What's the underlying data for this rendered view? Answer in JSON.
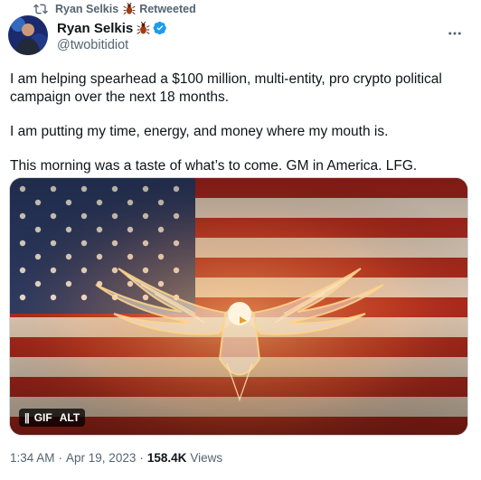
{
  "retweet": {
    "retweeter": "Ryan Selkis",
    "label": "Retweeted"
  },
  "author": {
    "name": "Ryan Selkis",
    "handle": "@twobitidiot"
  },
  "tweet": {
    "paragraphs": [
      "I am helping spearhead a $100 million, multi-entity, pro crypto political campaign over the next 18 months.",
      "I am putting my time, energy, and money where my mouth is.",
      "This morning was a taste of what’s to come. GM in America. LFG."
    ]
  },
  "media": {
    "pause_label": "||",
    "gif_label": "GIF",
    "alt_label": "ALT"
  },
  "meta": {
    "time": "1:34 AM",
    "sep1": "·",
    "date": "Apr 19, 2023",
    "sep2": "·",
    "views": "158.4K",
    "views_label": "Views"
  },
  "colors": {
    "verified": "#1d9bf0",
    "secondary_text": "#536471",
    "text": "#0f1419"
  },
  "icons": [
    "retweet-icon",
    "bug-icon",
    "verified-badge-icon",
    "more-icon",
    "pause-icon"
  ]
}
